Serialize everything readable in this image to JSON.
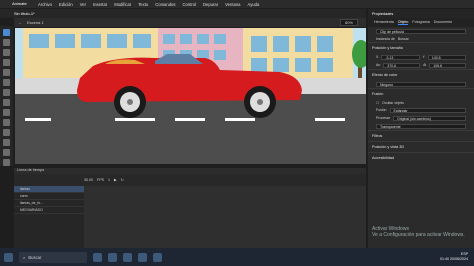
{
  "menu": {
    "workspace": "Animate",
    "items": [
      "Archivo",
      "Edición",
      "Ver",
      "Insertar",
      "Modificar",
      "Texto",
      "Comandos",
      "Control",
      "Depurar",
      "Ventana",
      "Ayuda"
    ]
  },
  "doc_tab": "Sin título-1*",
  "scene": {
    "name": "Escena 1",
    "zoom": "80%"
  },
  "properties": {
    "title": "Propiedades",
    "tabs": [
      "Herramienta",
      "Objeto",
      "Fotograma",
      "Documento"
    ],
    "sections": {
      "clip": "Clip de película",
      "instance": "Instancia de",
      "instance_name": "Buscar",
      "position": "Posición y tamaño",
      "x_label": "X",
      "x": "-3.13",
      "y_label": "Y",
      "y": "140.5",
      "w_label": "An",
      "w": "370.6",
      "h_label": "Al",
      "h": "105.6",
      "color": "Efecto de color",
      "color_value": "Ninguno",
      "fusion": "Fusión",
      "cache": "Ocultar objeto",
      "mix_label": "Fusión",
      "mix": "Estándar",
      "render_label": "Procesar",
      "render": "Original (sin cambios)",
      "transparent": "Transparente",
      "filters": "Filtros",
      "pos3d": "Posición y vista 3D",
      "access": "Accesibilidad"
    }
  },
  "timeline": {
    "title": "Línea de tiempo",
    "fps": "30.00",
    "fps_unit": "FPS",
    "frame": "1",
    "layers": [
      "llantas",
      "carro",
      "llantas_de_fo...",
      "MEOVARIADO"
    ]
  },
  "watermark": {
    "line1": "Activar Windows",
    "line2": "Ve a Configuración para activar Windows."
  },
  "taskbar": {
    "search": "Buscar",
    "time": "01:40",
    "date": "20/06/2024",
    "lang": "ESP"
  },
  "colors": {
    "car": "#d51b1e",
    "sky": "#bfe0ee",
    "road": "#4d4d4d"
  }
}
